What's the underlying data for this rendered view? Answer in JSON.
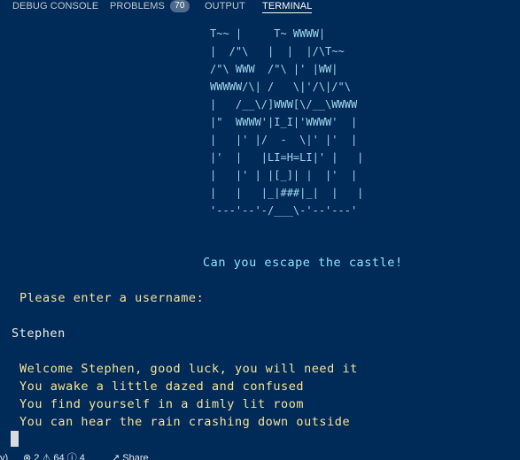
{
  "panel": {
    "tabs": [
      {
        "label": "DEBUG CONSOLE"
      },
      {
        "label": "PROBLEMS",
        "badge": "70"
      },
      {
        "label": "OUTPUT"
      },
      {
        "label": "TERMINAL",
        "active": true
      }
    ]
  },
  "terminal": {
    "ascii_art": "T~~ |     T~ WWWW|\n|  /\"\\   |  |  |/\\T~~\n/\"\\ WWW  /\"\\ |' |WW|\nWWWWW/\\| /   \\|'/\\|/\"\\\n|   /__\\/]WWW[\\/__\\WWWW\n|\"  WWWW'|I_I|'WWWW'  |\n|   |' |/  -  \\|' |'  |\n|'  |   |LI=H=LI|' |   |\n|   |' | |[_]| |  |'  |\n|   |   |_|###|_|  |   |\n'---'--'-/___\\-'--'---'",
    "tagline": "Can you escape the castle!",
    "prompt": "Please enter a username:",
    "user_input": "Stephen",
    "messages": [
      "Welcome Stephen, good luck, you will need it",
      "You awake a little dazed and confused",
      "You find yourself in a dimly lit room",
      "You can hear the rain crashing down outside"
    ]
  },
  "statusbar": {
    "left_fragment": "v)",
    "errors": "2",
    "warnings": "64",
    "info": "4",
    "share_label": "Share"
  },
  "colors": {
    "background": "#002a57",
    "ascii": "#9fd8ef",
    "text": "#f7e49b",
    "tagline": "#8fe3ff"
  }
}
